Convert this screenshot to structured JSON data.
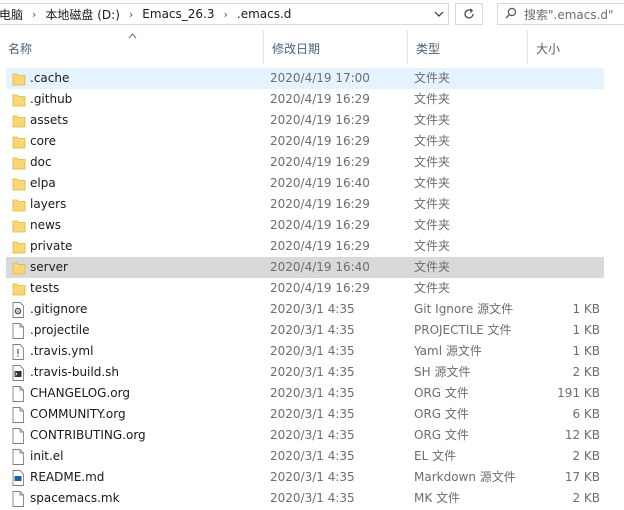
{
  "breadcrumb": {
    "items": [
      "电脑",
      "本地磁盘 (D:)",
      "Emacs_26.3",
      ".emacs.d"
    ],
    "separator": "›"
  },
  "address_dropdown_icon": "chevron-down-icon",
  "refresh_icon": "refresh-icon",
  "search": {
    "placeholder": "搜索\".emacs.d\"",
    "icon": "search-icon"
  },
  "columns": {
    "name": "名称",
    "date": "修改日期",
    "type": "类型",
    "size": "大小"
  },
  "colors": {
    "selected": "#e5f3ff",
    "hover": "#d9d9d9",
    "folder": "#f8d775",
    "header_text": "#4c607a"
  },
  "files": [
    {
      "name": ".cache",
      "date": "2020/4/19 17:00",
      "type": "文件夹",
      "size": "",
      "icon": "folder-icon",
      "state": "selected"
    },
    {
      "name": ".github",
      "date": "2020/4/19 16:29",
      "type": "文件夹",
      "size": "",
      "icon": "folder-icon"
    },
    {
      "name": "assets",
      "date": "2020/4/19 16:29",
      "type": "文件夹",
      "size": "",
      "icon": "folder-icon"
    },
    {
      "name": "core",
      "date": "2020/4/19 16:29",
      "type": "文件夹",
      "size": "",
      "icon": "folder-icon"
    },
    {
      "name": "doc",
      "date": "2020/4/19 16:29",
      "type": "文件夹",
      "size": "",
      "icon": "folder-icon"
    },
    {
      "name": "elpa",
      "date": "2020/4/19 16:40",
      "type": "文件夹",
      "size": "",
      "icon": "folder-icon"
    },
    {
      "name": "layers",
      "date": "2020/4/19 16:29",
      "type": "文件夹",
      "size": "",
      "icon": "folder-icon"
    },
    {
      "name": "news",
      "date": "2020/4/19 16:29",
      "type": "文件夹",
      "size": "",
      "icon": "folder-icon"
    },
    {
      "name": "private",
      "date": "2020/4/19 16:29",
      "type": "文件夹",
      "size": "",
      "icon": "folder-icon"
    },
    {
      "name": "server",
      "date": "2020/4/19 16:40",
      "type": "文件夹",
      "size": "",
      "icon": "folder-icon",
      "state": "hover"
    },
    {
      "name": "tests",
      "date": "2020/4/19 16:29",
      "type": "文件夹",
      "size": "",
      "icon": "folder-icon"
    },
    {
      "name": ".gitignore",
      "date": "2020/3/1 4:35",
      "type": "Git Ignore 源文件",
      "size": "1 KB",
      "icon": "gear-file-icon"
    },
    {
      "name": ".projectile",
      "date": "2020/3/1 4:35",
      "type": "PROJECTILE 文件",
      "size": "1 KB",
      "icon": "file-icon"
    },
    {
      "name": ".travis.yml",
      "date": "2020/3/1 4:35",
      "type": "Yaml 源文件",
      "size": "1 KB",
      "icon": "script-file-icon"
    },
    {
      "name": ".travis-build.sh",
      "date": "2020/3/1 4:35",
      "type": "SH 源文件",
      "size": "2 KB",
      "icon": "terminal-file-icon"
    },
    {
      "name": "CHANGELOG.org",
      "date": "2020/3/1 4:35",
      "type": "ORG 文件",
      "size": "191 KB",
      "icon": "file-icon"
    },
    {
      "name": "COMMUNITY.org",
      "date": "2020/3/1 4:35",
      "type": "ORG 文件",
      "size": "6 KB",
      "icon": "file-icon"
    },
    {
      "name": "CONTRIBUTING.org",
      "date": "2020/3/1 4:35",
      "type": "ORG 文件",
      "size": "12 KB",
      "icon": "file-icon"
    },
    {
      "name": "init.el",
      "date": "2020/3/1 4:35",
      "type": "EL 文件",
      "size": "2 KB",
      "icon": "file-icon"
    },
    {
      "name": "README.md",
      "date": "2020/3/1 4:35",
      "type": "Markdown 源文件",
      "size": "17 KB",
      "icon": "markdown-file-icon"
    },
    {
      "name": "spacemacs.mk",
      "date": "2020/3/1 4:35",
      "type": "MK 文件",
      "size": "2 KB",
      "icon": "file-icon"
    }
  ]
}
